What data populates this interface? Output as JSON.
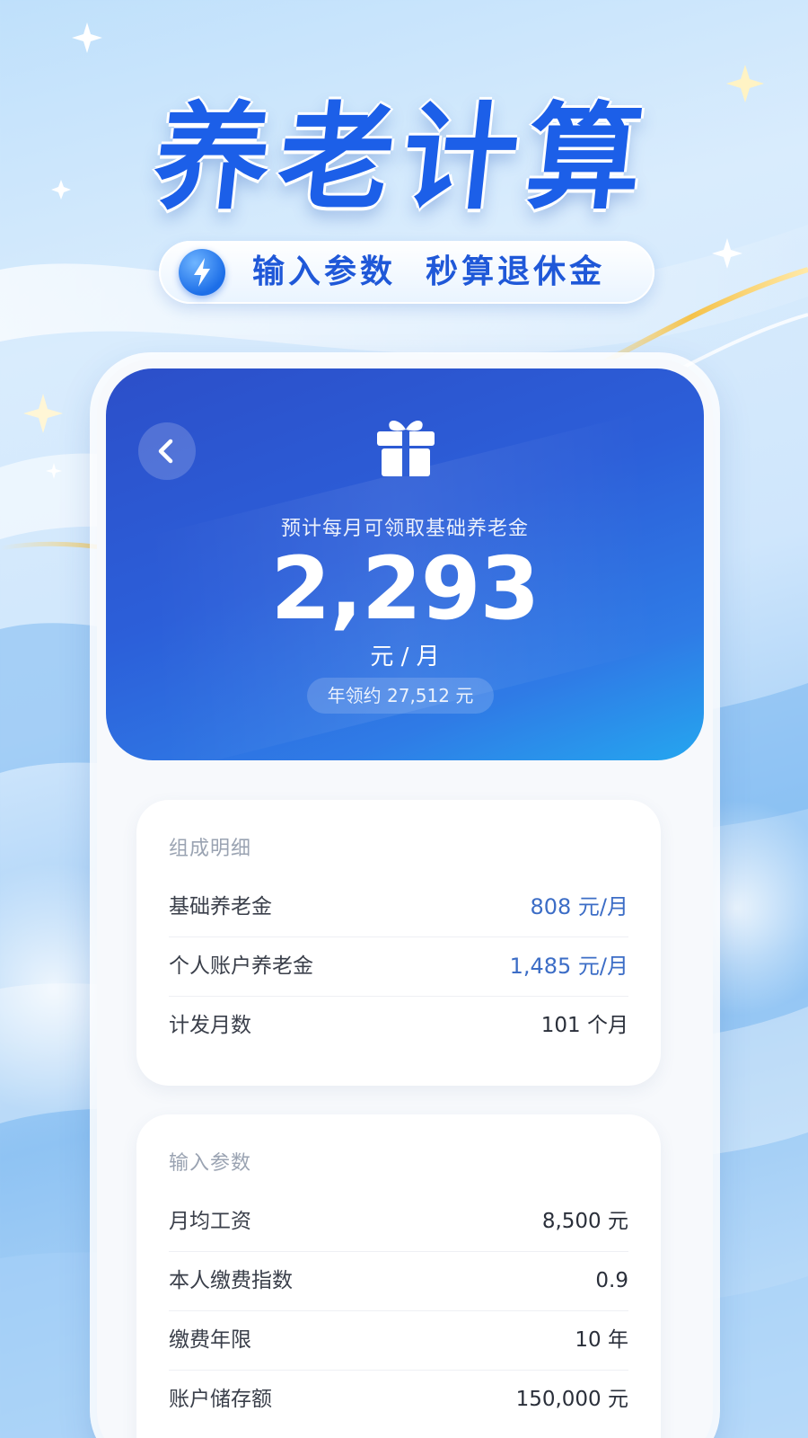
{
  "banner": {
    "headline": "养老计算",
    "tagline": "输入参数  秒算退休金",
    "tagline_icon": "lightning-bolt-icon"
  },
  "result": {
    "back_icon": "chevron-left-icon",
    "gift_icon": "gift-icon",
    "subtitle": "预计每月可领取基础养老金",
    "amount": "2,293",
    "unit": "元 / 月",
    "annual": "年领约 27,512 元"
  },
  "breakdown": {
    "title": "组成明细",
    "rows": [
      {
        "label": "基础养老金",
        "value": "808 元/月"
      },
      {
        "label": "个人账户养老金",
        "value": "1,485 元/月"
      },
      {
        "label": "计发月数",
        "value": "101 个月"
      }
    ]
  },
  "inputs": {
    "title": "输入参数",
    "rows": [
      {
        "label": "月均工资",
        "value": "8,500 元"
      },
      {
        "label": "本人缴费指数",
        "value": "0.9"
      },
      {
        "label": "缴费年限",
        "value": "10 年"
      },
      {
        "label": "账户储存额",
        "value": "150,000 元"
      }
    ]
  },
  "colors": {
    "accent": "#1c5fe8",
    "hero_start": "#2c4fc9",
    "hero_end": "#25a6ef",
    "value_blue": "#3c6dc6"
  }
}
